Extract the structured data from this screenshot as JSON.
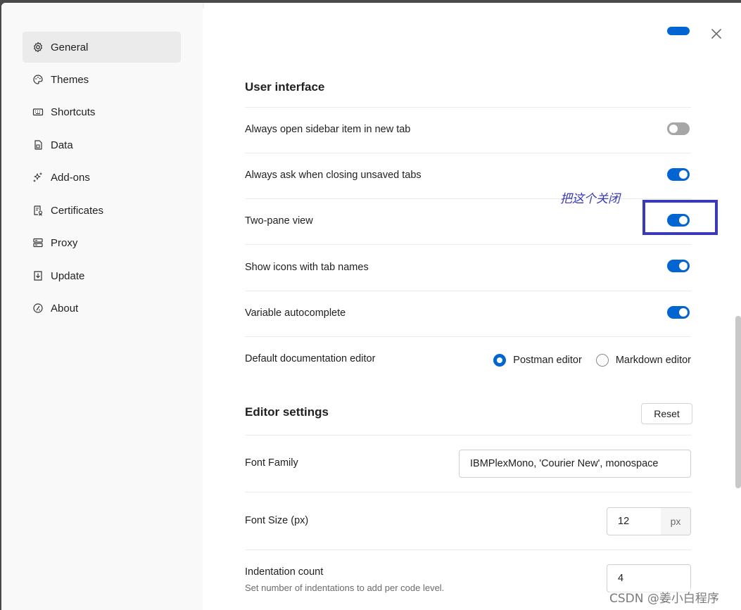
{
  "sidebar": {
    "items": [
      {
        "label": "General",
        "icon": "gear-icon",
        "active": true
      },
      {
        "label": "Themes",
        "icon": "palette-icon",
        "active": false
      },
      {
        "label": "Shortcuts",
        "icon": "keyboard-icon",
        "active": false
      },
      {
        "label": "Data",
        "icon": "database-icon",
        "active": false
      },
      {
        "label": "Add-ons",
        "icon": "sparkle-icon",
        "active": false
      },
      {
        "label": "Certificates",
        "icon": "certificate-icon",
        "active": false
      },
      {
        "label": "Proxy",
        "icon": "server-icon",
        "active": false
      },
      {
        "label": "Update",
        "icon": "download-icon",
        "active": false
      },
      {
        "label": "About",
        "icon": "info-icon",
        "active": false
      }
    ]
  },
  "user_interface": {
    "title": "User interface",
    "rows": [
      {
        "label": "Always open sidebar item in new tab",
        "enabled": false
      },
      {
        "label": "Always ask when closing unsaved tabs",
        "enabled": true
      },
      {
        "label": "Two-pane view",
        "enabled": true
      },
      {
        "label": "Show icons with tab names",
        "enabled": true
      },
      {
        "label": "Variable autocomplete",
        "enabled": true
      }
    ],
    "doc_editor": {
      "label": "Default documentation editor",
      "options": [
        "Postman editor",
        "Markdown editor"
      ],
      "selected": "Postman editor"
    }
  },
  "editor_settings": {
    "title": "Editor settings",
    "reset_label": "Reset",
    "font_family": {
      "label": "Font Family",
      "value": "IBMPlexMono, 'Courier New', monospace"
    },
    "font_size": {
      "label": "Font Size (px)",
      "value": "12",
      "unit": "px"
    },
    "indentation": {
      "label": "Indentation count",
      "sublabel": "Set number of indentations to add per code level.",
      "value": "4"
    }
  },
  "annotation": {
    "text": "把这个关闭",
    "color": "#3a3ab8"
  },
  "watermark": "CSDN @姜小白程序",
  "colors": {
    "accent": "#0265d2",
    "toggle_off": "#a6a6a6"
  }
}
